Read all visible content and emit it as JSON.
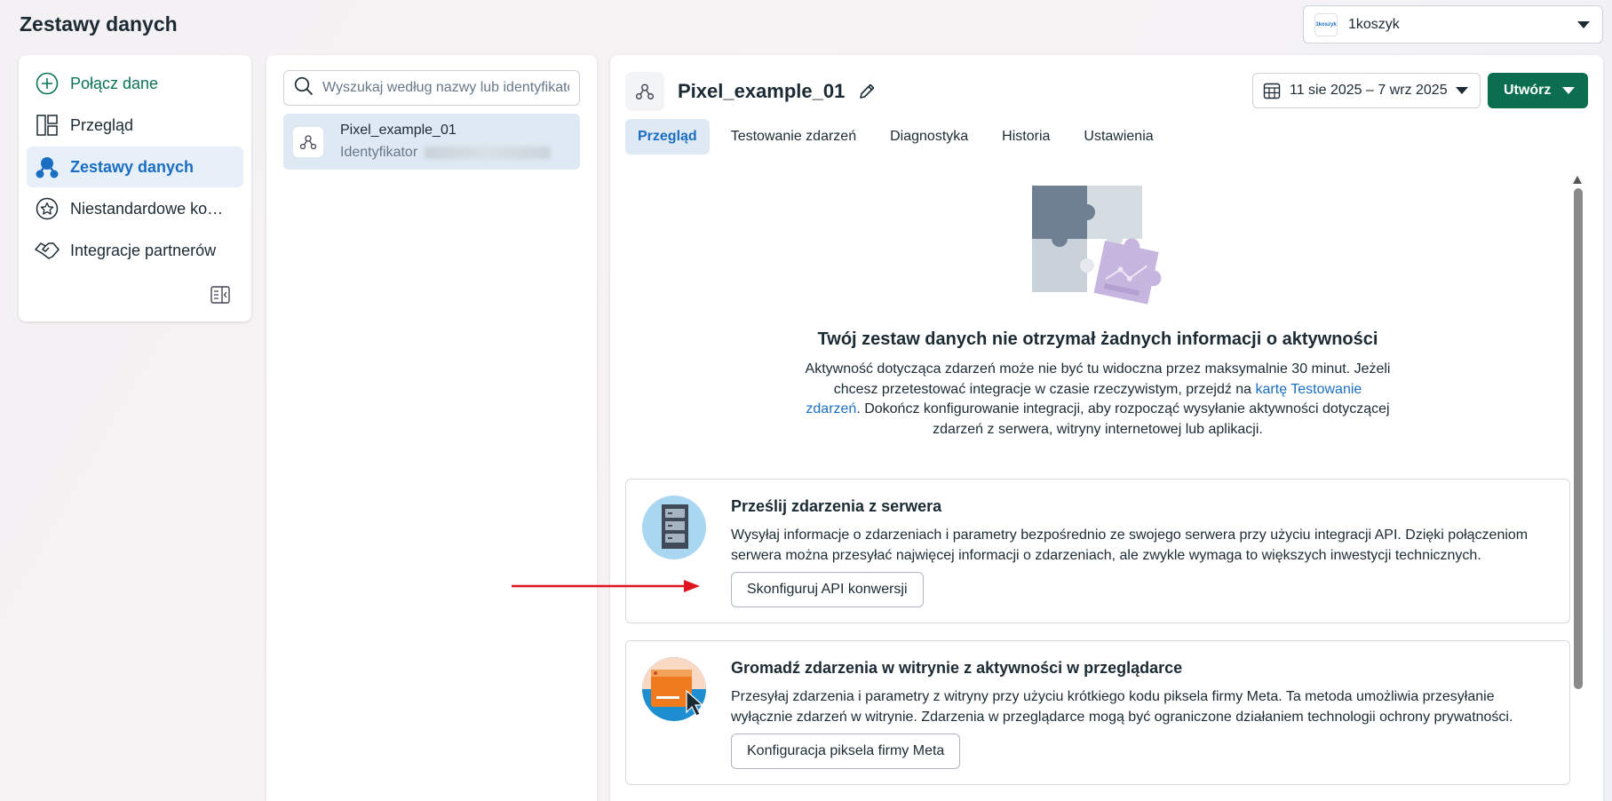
{
  "page": {
    "title": "Zestawy danych"
  },
  "account": {
    "name": "1koszyk",
    "logo_text": "1koszyk"
  },
  "nav": {
    "items": [
      {
        "label": "Połącz dane",
        "icon": "plus-circle-icon"
      },
      {
        "label": "Przegląd",
        "icon": "layout-icon"
      },
      {
        "label": "Zestawy danych",
        "icon": "datasets-icon"
      },
      {
        "label": "Niestandardowe ko…",
        "icon": "star-badge-icon"
      },
      {
        "label": "Integracje partnerów",
        "icon": "handshake-icon"
      }
    ],
    "active_index": 2
  },
  "list": {
    "search_placeholder": "Wyszukaj według nazwy lub identyfikatora",
    "datasets": [
      {
        "name": "Pixel_example_01",
        "id_label": "Identyfikator"
      }
    ]
  },
  "main": {
    "dataset_name": "Pixel_example_01",
    "date_range": "11 sie 2025 – 7 wrz 2025",
    "create_label": "Utwórz",
    "tabs": [
      "Przegląd",
      "Testowanie zdarzeń",
      "Diagnostyka",
      "Historia",
      "Ustawienia"
    ],
    "active_tab": 0,
    "empty_state": {
      "title": "Twój zestaw danych nie otrzymał żadnych informacji o aktywności",
      "desc_part1": "Aktywność dotycząca zdarzeń może nie być tu widoczna przez maksymalnie 30 minut. Jeżeli chcesz przetestować integracje w czasie rzeczywistym, przejdź na ",
      "desc_link": "kartę Testowanie zdarzeń",
      "desc_part2": ". Dokończ konfigurowanie integracji, aby rozpocząć wysyłanie aktywności dotyczącej zdarzeń z serwera, witryny internetowej lub aplikacji."
    },
    "cards": [
      {
        "title": "Prześlij zdarzenia z serwera",
        "desc": "Wysyłaj informacje o zdarzeniach i parametry bezpośrednio ze swojego serwera przy użyciu integracji API. Dzięki połączeniom serwera można przesyłać najwięcej informacji o zdarzeniach, ale zwykle wymaga to większych inwestycji technicznych.",
        "button": "Skonfiguruj API konwersji"
      },
      {
        "title": "Gromadź zdarzenia w witrynie z aktywności w przeglądarce",
        "desc": "Przesyłaj zdarzenia i parametry z witryny przy użyciu krótkiego kodu piksela firmy Meta. Ta metoda umożliwia przesyłanie wyłącznie zdarzeń w witrynie. Zdarzenia w przeglądarce mogą być ograniczone działaniem technologii ochrony prywatności.",
        "button": "Konfiguracja piksela firmy Meta"
      }
    ]
  },
  "colors": {
    "accent_blue": "#1a6ec2",
    "create_green": "#0b6e4f",
    "connect_green": "#0a7355",
    "annotation_red": "#e0141e"
  }
}
